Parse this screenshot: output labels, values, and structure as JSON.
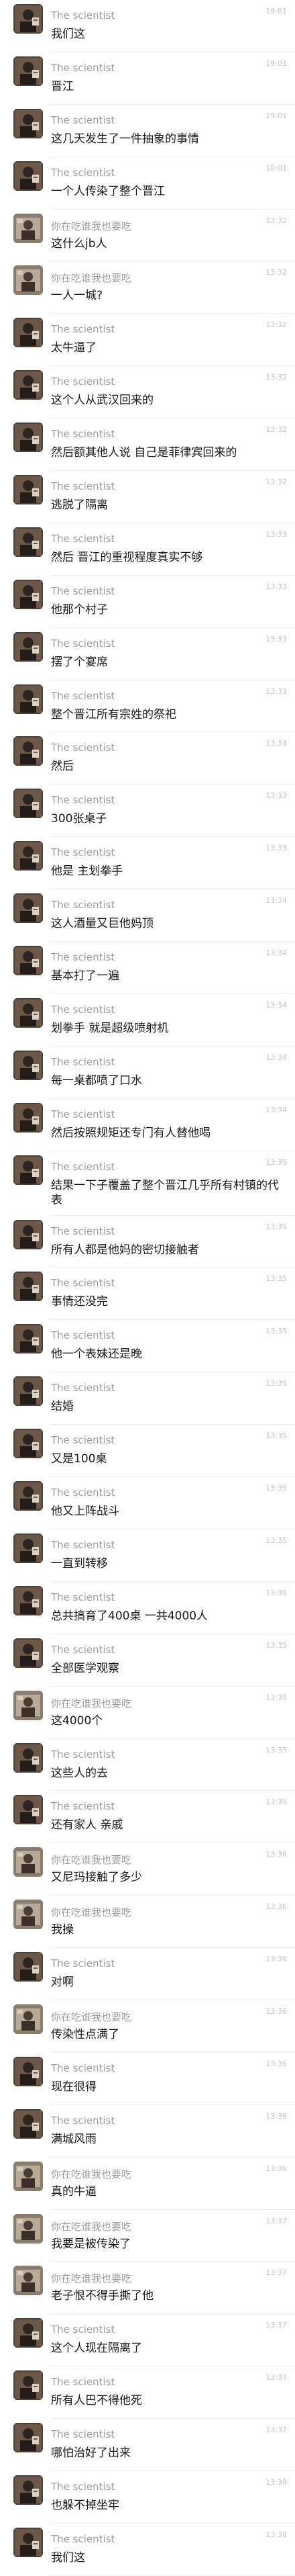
{
  "names": {
    "scientist": "The scientist",
    "user": "你在吃谁我也要吃"
  },
  "messages": [
    {
      "sender": "scientist",
      "time": "19:01",
      "text": "我们这"
    },
    {
      "sender": "scientist",
      "time": "19:01",
      "text": "晋江"
    },
    {
      "sender": "scientist",
      "time": "19:01",
      "text": "这几天发生了一件抽象的事情"
    },
    {
      "sender": "scientist",
      "time": "19:01",
      "text": "一个人传染了整个晋江"
    },
    {
      "sender": "user",
      "time": "13:32",
      "text": "这什么jb人"
    },
    {
      "sender": "user",
      "time": "13:32",
      "text": "一人一城?"
    },
    {
      "sender": "scientist",
      "time": "13:32",
      "text": "太牛逼了"
    },
    {
      "sender": "scientist",
      "time": "13:32",
      "text": "这个人从武汉回来的"
    },
    {
      "sender": "scientist",
      "time": "13:32",
      "text": "然后额其他人说 自己是菲律宾回来的"
    },
    {
      "sender": "scientist",
      "time": "13:32",
      "text": "逃脱了隔离"
    },
    {
      "sender": "scientist",
      "time": "13:33",
      "text": "然后 晋江的重视程度真实不够"
    },
    {
      "sender": "scientist",
      "time": "13:33",
      "text": "他那个村子"
    },
    {
      "sender": "scientist",
      "time": "13:33",
      "text": "摆了个宴席"
    },
    {
      "sender": "scientist",
      "time": "13:33",
      "text": "整个晋江所有宗姓的祭祀"
    },
    {
      "sender": "scientist",
      "time": "13:33",
      "text": "然后"
    },
    {
      "sender": "scientist",
      "time": "13:33",
      "text": "300张桌子"
    },
    {
      "sender": "scientist",
      "time": "13:33",
      "text": "他是 主划拳手"
    },
    {
      "sender": "scientist",
      "time": "13:34",
      "text": "这人酒量又巨他妈顶"
    },
    {
      "sender": "scientist",
      "time": "13:34",
      "text": "基本打了一遍"
    },
    {
      "sender": "scientist",
      "time": "13:34",
      "text": "划拳手 就是超级喷射机"
    },
    {
      "sender": "scientist",
      "time": "13:34",
      "text": "每一桌都喷了口水"
    },
    {
      "sender": "scientist",
      "time": "13:34",
      "text": "然后按照规矩还专门有人替他喝"
    },
    {
      "sender": "scientist",
      "time": "13:35",
      "text": "结果一下子覆盖了整个晋江几乎所有村镇的代表"
    },
    {
      "sender": "scientist",
      "time": "13:35",
      "text": "所有人都是他妈的密切接触者"
    },
    {
      "sender": "scientist",
      "time": "13:35",
      "text": "事情还没完"
    },
    {
      "sender": "scientist",
      "time": "13:35",
      "text": "他一个表妹还是晚"
    },
    {
      "sender": "scientist",
      "time": "13:35",
      "text": "结婚"
    },
    {
      "sender": "scientist",
      "time": "13:35",
      "text": "又是100桌"
    },
    {
      "sender": "scientist",
      "time": "13:35",
      "text": "他又上阵战斗"
    },
    {
      "sender": "scientist",
      "time": "13:35",
      "text": "一直到转移"
    },
    {
      "sender": "scientist",
      "time": "13:35",
      "text": "总共搞育了400桌 一共4000人"
    },
    {
      "sender": "scientist",
      "time": "13:35",
      "text": "全部医学观察"
    },
    {
      "sender": "user",
      "time": "13:35",
      "text": "这4000个"
    },
    {
      "sender": "scientist",
      "time": "13:35",
      "text": "这些人的去"
    },
    {
      "sender": "scientist",
      "time": "13:35",
      "text": "还有家人 亲戚"
    },
    {
      "sender": "user",
      "time": "13:36",
      "text": "又尼玛接触了多少"
    },
    {
      "sender": "user",
      "time": "13:36",
      "text": "我操"
    },
    {
      "sender": "scientist",
      "time": "13:36",
      "text": "对啊"
    },
    {
      "sender": "user",
      "time": "13:36",
      "text": "传染性点满了"
    },
    {
      "sender": "scientist",
      "time": "13:36",
      "text": "现在很得"
    },
    {
      "sender": "scientist",
      "time": "13:36",
      "text": "满城风雨"
    },
    {
      "sender": "user",
      "time": "13:36",
      "text": "真的牛逼"
    },
    {
      "sender": "user",
      "time": "13:37",
      "text": "我要是被传染了"
    },
    {
      "sender": "user",
      "time": "13:37",
      "text": "老子恨不得手撕了他"
    },
    {
      "sender": "scientist",
      "time": "13:37",
      "text": "这个人现在隔离了"
    },
    {
      "sender": "scientist",
      "time": "13:37",
      "text": "所有人巴不得他死"
    },
    {
      "sender": "scientist",
      "time": "13:37",
      "text": "哪怕治好了出来"
    },
    {
      "sender": "scientist",
      "time": "13:38",
      "text": "也躲不掉坐牢"
    },
    {
      "sender": "scientist",
      "time": "13:38",
      "text": "我们这"
    }
  ]
}
